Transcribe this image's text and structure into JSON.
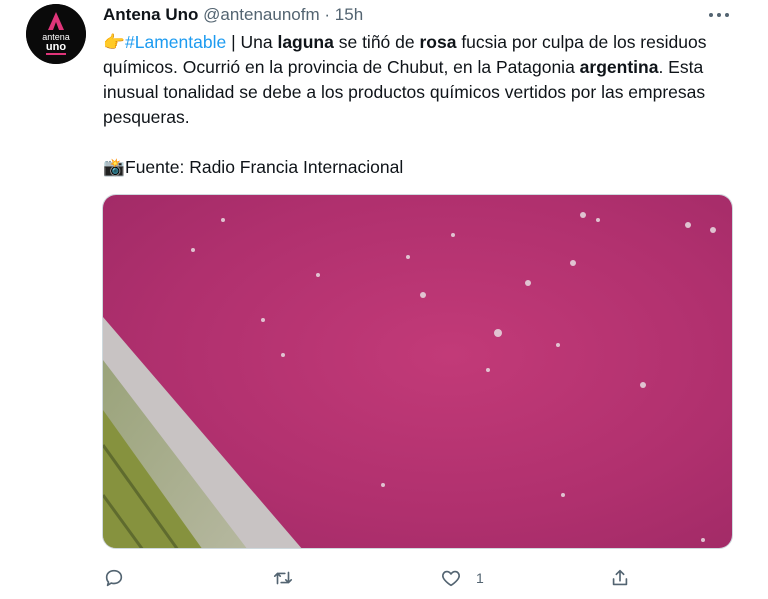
{
  "account": {
    "display_name": "Antena Uno",
    "handle": "@antenaunofm",
    "separator": "·",
    "time": "15h",
    "avatar_text": "antena uno"
  },
  "tweet": {
    "line1": {
      "hashtag": "#Lamentable",
      "t1": " | Una ",
      "b1": "laguna",
      "t2": " se tiñó de ",
      "b2": "rosa",
      "t3": " fucsia por culpa de los residuos químicos. Ocurrió en la provincia de Chubut, en la Patagonia ",
      "b3": "argentina",
      "t4": ". Esta inusual tonalidad se debe a los productos químicos vertidos por las empresas pesqueras."
    },
    "source": "Fuente: Radio Francia Internacional",
    "emoji_point": "👉",
    "emoji_camera": "📸"
  },
  "media": {
    "description_color": "#b0306e"
  },
  "actions": {
    "reply_icon": "reply-icon",
    "retweet_icon": "retweet-icon",
    "like_icon": "heart-icon",
    "like_count": "1",
    "share_icon": "share-icon"
  },
  "colors": {
    "accent": "#1d9bf0",
    "secondary_text": "#536471",
    "lagoon": "#b0306e"
  }
}
